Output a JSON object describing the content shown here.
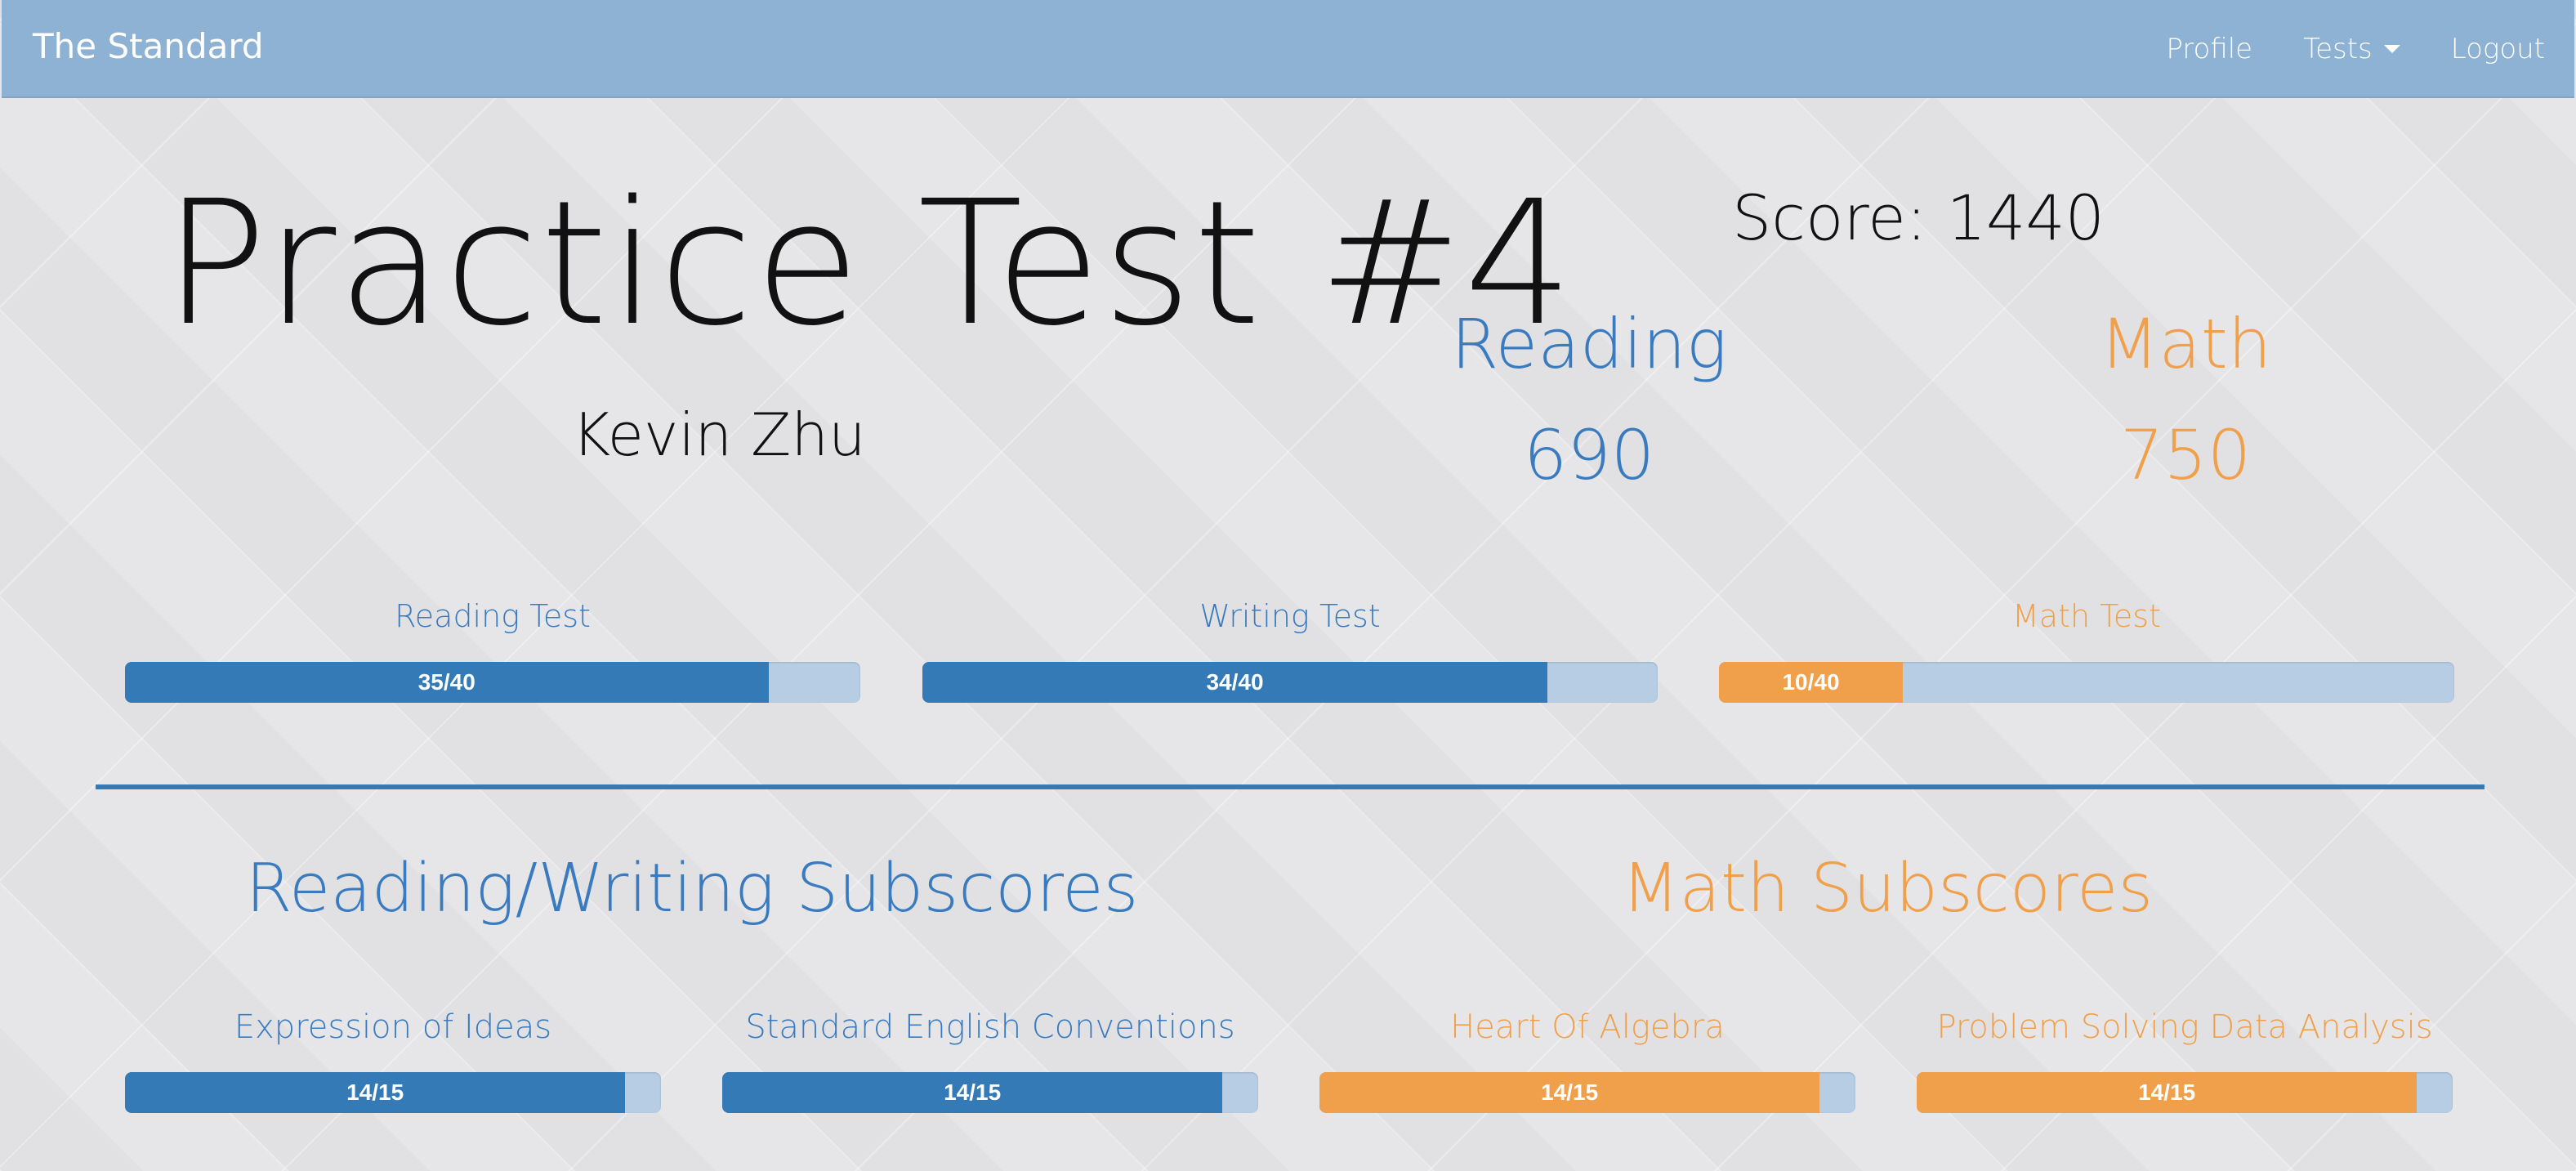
{
  "nav": {
    "brand": "The Standard",
    "profile": "Profile",
    "tests": "Tests",
    "logout": "Logout"
  },
  "header": {
    "test_title": "Practice Test #4",
    "student": "Kevin Zhu",
    "total_score": "Score: 1440"
  },
  "sections": {
    "reading_label": "Reading",
    "reading_score": "690",
    "math_label": "Math",
    "math_score": "750"
  },
  "tests": [
    {
      "label": "Reading Test",
      "text": "35/40",
      "fraction": 0.875
    },
    {
      "label": "Writing Test",
      "text": "34/40",
      "fraction": 0.85
    },
    {
      "label": "Math Test",
      "text": "10/40",
      "fraction": 0.25
    }
  ],
  "subscores": {
    "rw_title": "Reading/Writing Subscores",
    "math_title": "Math Subscores",
    "items": [
      {
        "label": "Expression of Ideas",
        "text": "14/15",
        "fraction": 0.9333
      },
      {
        "label": "Standard English Conventions",
        "text": "14/15",
        "fraction": 0.9333
      },
      {
        "label": "Heart Of Algebra",
        "text": "14/15",
        "fraction": 0.9333
      },
      {
        "label": "Problem Solving Data Analysis",
        "text": "14/15",
        "fraction": 0.9333
      }
    ]
  },
  "colors": {
    "reading_blue": "#337ab7",
    "math_orange": "#f0a04b",
    "track": "#b7cde4",
    "navbar": "#8db2d4"
  }
}
